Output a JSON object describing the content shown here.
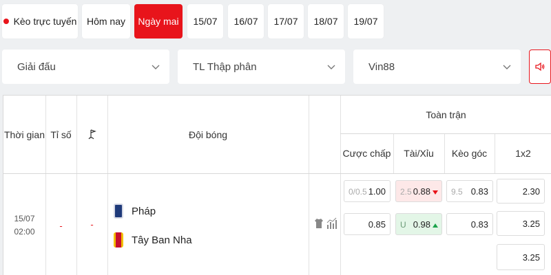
{
  "tabs": {
    "live": "Kèo trực tuyến",
    "today": "Hôm nay",
    "tomorrow": "Ngày mai",
    "d1": "15/07",
    "d2": "16/07",
    "d3": "17/07",
    "d4": "18/07",
    "d5": "19/07"
  },
  "filters": {
    "league": "Giải đấu",
    "odds_format": "TL Thập phân",
    "bookmaker": "Vin88"
  },
  "table": {
    "headers": {
      "time": "Thời gian",
      "score": "Tỉ số",
      "team": "Đội bóng",
      "full_match": "Toàn trận",
      "handicap": "Cược chấp",
      "over_under": "Tài/Xỉu",
      "corners": "Kèo góc",
      "one_x_two": "1x2"
    },
    "match": {
      "date": "15/07",
      "time": "02:00",
      "score": "-",
      "corner_score": "-",
      "home_team": "Pháp",
      "away_team": "Tây Ban Nha",
      "handicap": {
        "line": "0/0.5",
        "home": "1.00",
        "away": "0.85"
      },
      "over_under": {
        "line": "2.5",
        "over": "0.88",
        "under_label": "U",
        "under": "0.98"
      },
      "corners": {
        "line": "9.5",
        "over": "0.83",
        "under": "0.83"
      },
      "one_x_two": {
        "home": "2.30",
        "draw": "3.25",
        "away": "3.25"
      }
    }
  },
  "colors": {
    "accent": "#e8141b",
    "up": "#1aa34a",
    "down": "#e8141b"
  }
}
